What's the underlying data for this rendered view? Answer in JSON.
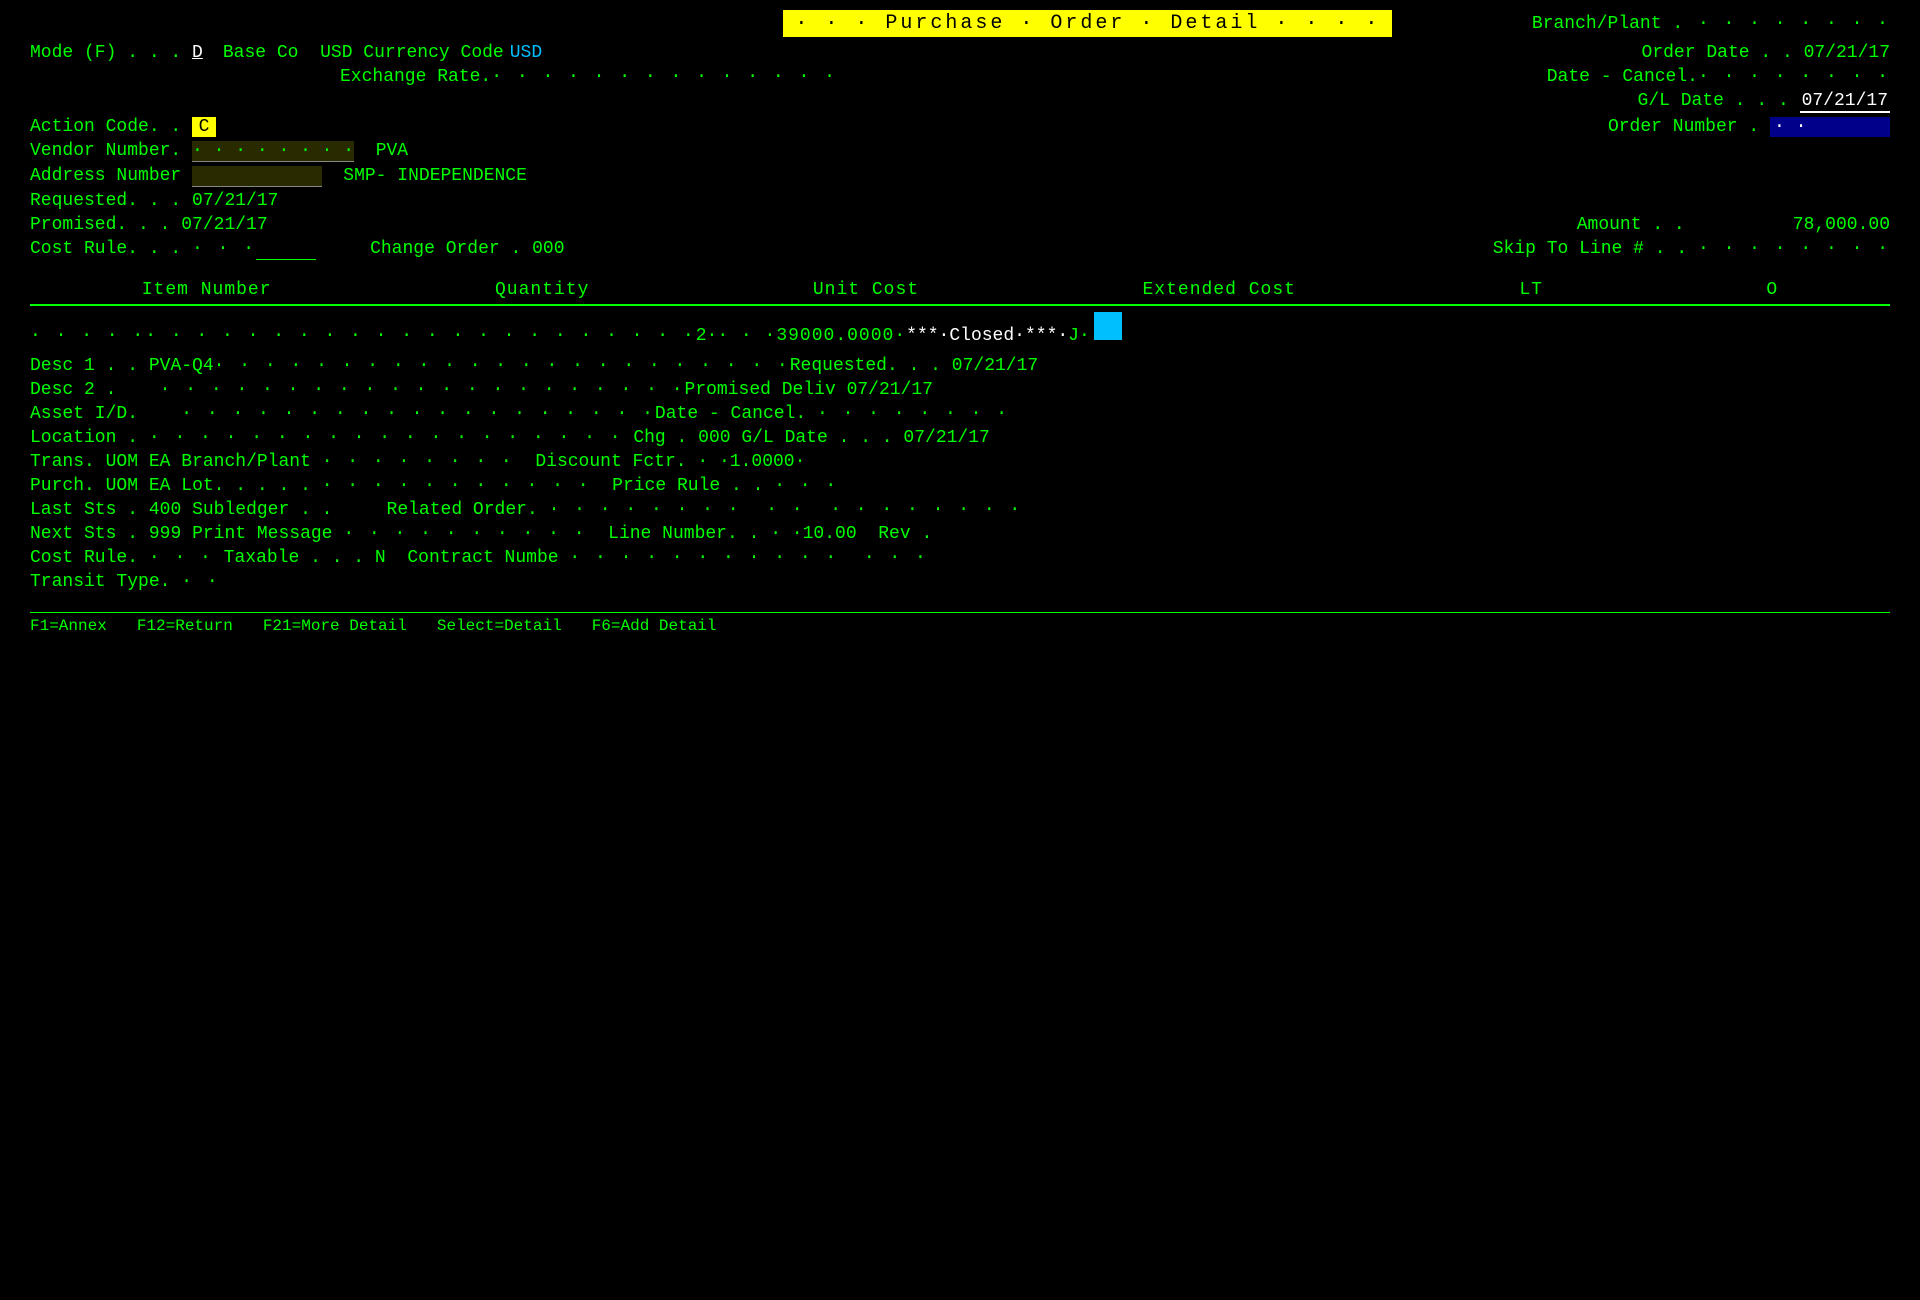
{
  "title": {
    "text": "· · · Purchase · Order · Detail · · · ·",
    "branch_plant_label": "Branch/Plant",
    "branch_plant_dots": " . · · · · · · · ·"
  },
  "header": {
    "mode_label": "Mode (F)",
    "mode_value": "D",
    "base_co_label": "Base Co",
    "currency_label": "USD Currency Code",
    "currency_value": "USD",
    "exchange_label": "Exchange Rate.",
    "exchange_dots": "· · · · · · · · · · · · · ·",
    "order_date_label": "Order Date",
    "order_date_value": "07/21/17",
    "date_cancel_label": "Date - Cancel.",
    "date_cancel_dots": "· · · · · · · ·",
    "gl_date_label": "G/L Date",
    "gl_date_value": "07/21/17",
    "action_code_label": "Action Code. .",
    "action_code_value": "C",
    "order_number_label": "Order Number .",
    "order_number_value": "· ·"
  },
  "vendor": {
    "vendor_number_label": "Vendor Number.",
    "vendor_number_dots": "· · · · · · · ·",
    "vendor_name": "PVA",
    "address_number_label": "Address Number",
    "address_dots": "",
    "address_name": "SMP- INDEPENDENCE",
    "requested_label": "Requested. . .",
    "requested_value": "07/21/17",
    "promised_label": "Promised. . .",
    "promised_value": "07/21/17",
    "amount_label": "Amount . .",
    "amount_value": "78,000.00",
    "cost_rule_label": "Cost Rule. . .",
    "cost_rule_dots": "· · ·",
    "change_order_label": "Change Order .",
    "change_order_value": "000",
    "skip_label": "Skip To Line # . .",
    "skip_dots": "· · · · · · · ·"
  },
  "table": {
    "col_item_number": "Item Number",
    "col_quantity": "Quantity",
    "col_unit_cost": "Unit Cost",
    "col_extended_cost": "Extended Cost",
    "col_lt": "LT",
    "col_o": "O"
  },
  "line_item": {
    "item_dots": "· · · · ·",
    "quantity_dots": "· · · · · · · · · · · · · · · · · · · · · ·",
    "quantity_value": "2·",
    "unit_cost": "· · ·39000.0000·",
    "extended_cost": "***·Closed·***·",
    "lt_value": "J·",
    "desc1_label": "Desc 1 . .",
    "desc1_value": "PVA-Q4",
    "desc1_dots": "· · · · · · · · · · · · · · · · · · · · · · ·",
    "requested_label": "Requested. . .",
    "requested_value": "07/21/17",
    "desc2_label": "Desc 2 .",
    "desc2_dots": "· · · · · · · · · · · · · · · · · · · · ·",
    "promised_label": "Promised Deliv",
    "promised_value": "07/21/17",
    "asset_label": "Asset I/D.",
    "asset_dots": "· · · · · · · · · · · · · · · · · · ·",
    "date_cancel_label": "Date - Cancel.",
    "date_cancel_dots": "· · · · · · · ·",
    "location_label": "Location .",
    "location_dots": "· · · · · · · · · · · · · · · · · · ·",
    "chg_label": "Chg .",
    "chg_value": "000",
    "gl_date_label": "G/L Date . . .",
    "gl_date_value": "07/21/17",
    "trans_label": "Trans. UOM",
    "trans_value": "EA",
    "branch_plant_label": "Branch/Plant",
    "branch_plant_dots": "· · · · · · · ·",
    "discount_label": "Discount Fctr.",
    "discount_value": "· ·1.0000·",
    "purch_label": "Purch. UOM",
    "purch_value": "EA",
    "lot_label": "Lot. . . . .",
    "lot_dots": "· · · · · · · · · · ·",
    "price_rule_label": "Price Rule . .",
    "price_rule_dots": "· · ·",
    "last_sts_label": "Last Sts .",
    "last_sts_value": "400",
    "subledger_label": "Subledger . .",
    "related_order_label": "Related Order.",
    "related_order_dots": "· · · · · · · ·  · ·  · · · · · · · ·",
    "next_sts_label": "Next Sts .",
    "next_sts_value": "999",
    "print_message_label": "Print Message",
    "print_message_dots": "· · · · · · · · · ·",
    "line_number_label": "Line Number. .",
    "line_number_value": "· ·10.00",
    "rev_label": "Rev .",
    "cost_rule_label": "Cost Rule.",
    "cost_rule_dots": "· · ·",
    "taxable_label": "Taxable . . .",
    "taxable_value": "N",
    "contract_label": "Contract Numbe",
    "contract_dots": "· · · · · · · · · · ·  · · ·",
    "transit_label": "Transit Type.",
    "transit_dots": "· ·"
  },
  "bottom_bar": {
    "items": [
      "F1=Annex",
      "F12=Return",
      "F21=More Detail",
      "Select=Detail",
      "F6=Add Detail"
    ]
  }
}
